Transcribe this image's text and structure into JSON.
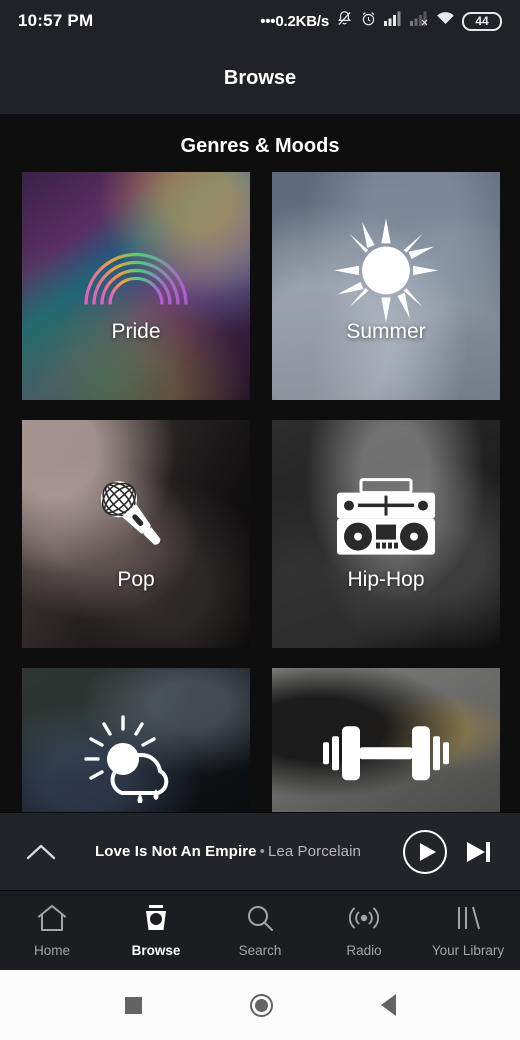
{
  "statusbar": {
    "time": "10:57 PM",
    "network_speed": "0.2KB/s",
    "dots": "•••",
    "battery_level": "44",
    "icons": [
      "notifications-muted-icon",
      "alarm-icon",
      "signal-bars-icon",
      "signal-bars-empty-icon",
      "wifi-icon",
      "battery-icon"
    ]
  },
  "appbar": {
    "title": "Browse"
  },
  "main": {
    "section_title": "Genres & Moods",
    "tiles": [
      {
        "label": "Pride",
        "icon": "rainbow-icon",
        "bg": "bg-pride"
      },
      {
        "label": "Summer",
        "icon": "sun-icon",
        "bg": "bg-summer"
      },
      {
        "label": "Pop",
        "icon": "microphone-icon",
        "bg": "bg-pop"
      },
      {
        "label": "Hip-Hop",
        "icon": "boombox-icon",
        "bg": "bg-hiphop"
      },
      {
        "label": "",
        "icon": "sun-cloud-rain-icon",
        "bg": "bg-chill"
      },
      {
        "label": "",
        "icon": "dumbbell-icon",
        "bg": "bg-workout"
      }
    ]
  },
  "nowplaying": {
    "expand_icon": "chevron-up-icon",
    "track_title": "Love Is Not An Empire",
    "separator": "•",
    "artist": "Lea Porcelain",
    "play_icon": "play-icon",
    "next_icon": "skip-next-icon"
  },
  "bottomnav": {
    "items": [
      {
        "label": "Home",
        "icon": "home-icon",
        "active": false
      },
      {
        "label": "Browse",
        "icon": "browse-icon",
        "active": true
      },
      {
        "label": "Search",
        "icon": "search-icon",
        "active": false
      },
      {
        "label": "Radio",
        "icon": "radio-icon",
        "active": false
      },
      {
        "label": "Your Library",
        "icon": "library-icon",
        "active": false
      }
    ]
  },
  "sysnav": {
    "recents": "recents-square-icon",
    "home": "home-circle-icon",
    "back": "back-triangle-icon"
  },
  "colors": {
    "header_bg": "#212228",
    "content_bg": "#0e0e0e",
    "nowplaying_bg": "#232429",
    "bottomnav_bg": "#1c1d21",
    "text_primary": "#ffffff",
    "text_secondary": "#a4a4a8"
  }
}
